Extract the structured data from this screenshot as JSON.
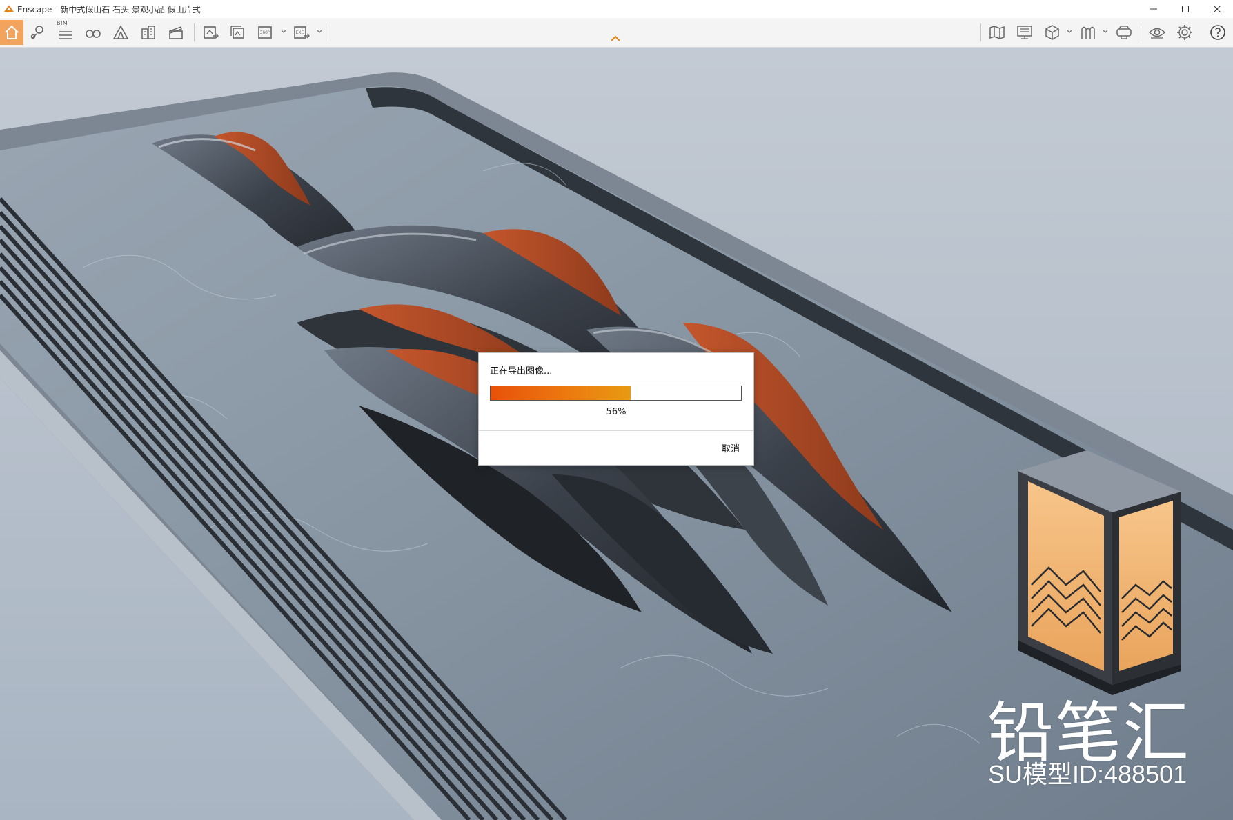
{
  "window": {
    "title": "Enscape - 新中式假山石 石头 景观小品 假山片式",
    "controls": [
      "minimize-icon",
      "maximize-icon",
      "close-icon"
    ]
  },
  "toolbar": {
    "bim_label": "BIM",
    "left_icons": [
      "home-icon",
      "location-pin-icon",
      "bim-list-icon",
      "binoculars-icon",
      "tent-icon",
      "buildings-icon",
      "clapperboard-icon",
      "screenshot-export-icon",
      "batch-export-icon",
      "panorama-360-icon",
      "exe-export-icon"
    ],
    "panorama_label": "360°",
    "exe_label": "EXE",
    "right_icons": [
      "map-icon",
      "monitor-icon",
      "cube-icon",
      "asset-library-icon",
      "vr-headset-icon",
      "eye-settings-icon",
      "gear-icon",
      "help-icon"
    ],
    "accent_color": "#f2a35e"
  },
  "dialog": {
    "title": "正在导出图像...",
    "progress_value": 0.56,
    "progress_text": "56%",
    "cancel_label": "取消",
    "progress_color": "#e8510a"
  },
  "watermark": {
    "brand": "铅笔汇",
    "model_id": "SU模型ID:488501"
  }
}
